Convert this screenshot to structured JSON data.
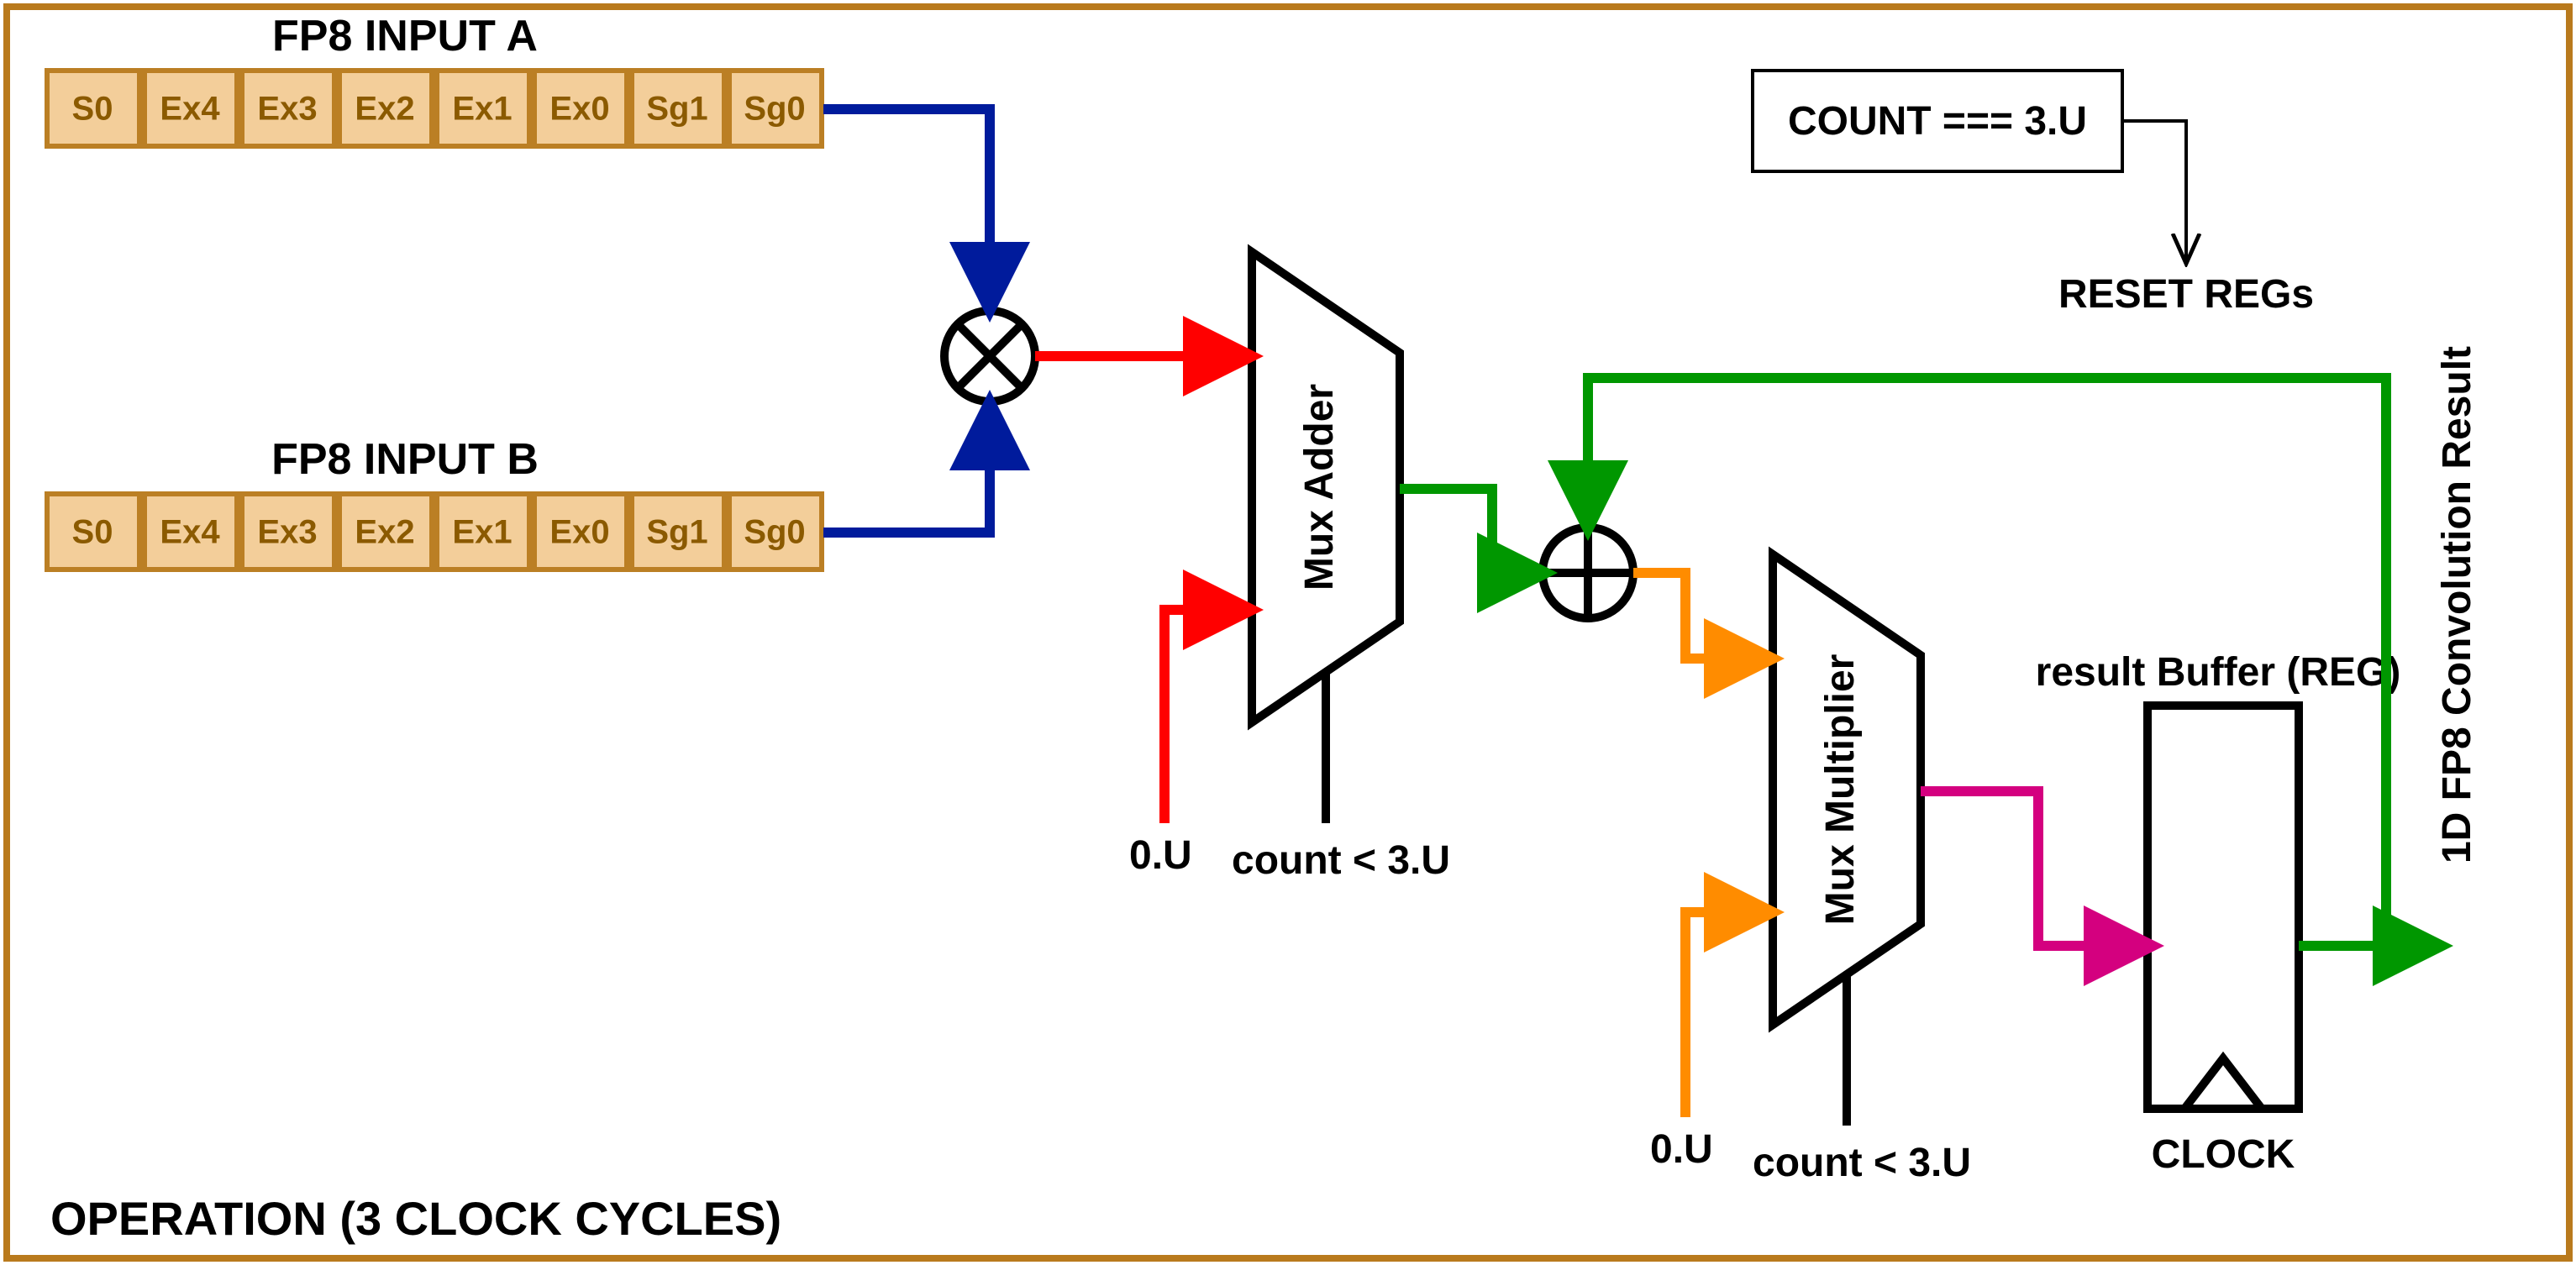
{
  "labels": {
    "input_a_title": "FP8 INPUT A",
    "input_b_title": "FP8 INPUT B",
    "bits": [
      "S0",
      "Ex4",
      "Ex3",
      "Ex2",
      "Ex1",
      "Ex0",
      "Sg1",
      "Sg0"
    ],
    "mux_adder": "Mux Adder",
    "mux_multiplier": "Mux Multiplier",
    "zero_u_1": "0.U",
    "zero_u_2": "0.U",
    "count_lt_1": "count < 3.U",
    "count_lt_2": "count < 3.U",
    "result_buffer": "result Buffer (REG)",
    "clock": "CLOCK",
    "count_eq": "COUNT === 3.U",
    "reset_regs": "RESET REGs",
    "output_label": "1D FP8 Convolution Result",
    "operation": "OPERATION (3 CLOCK CYCLES)"
  },
  "colors": {
    "border": "#b97a1d",
    "blue": "#001b9c",
    "red": "#ff0000",
    "green": "#009700",
    "orange": "#ff8c00",
    "magenta": "#d4007f",
    "black": "#000000"
  }
}
